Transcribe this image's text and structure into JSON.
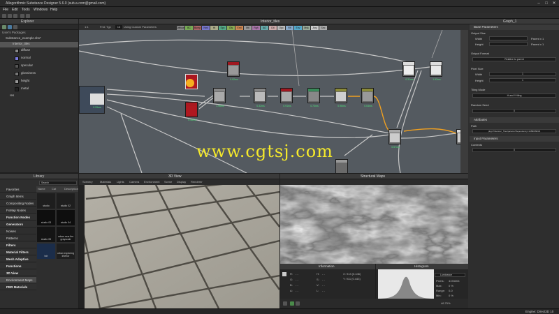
{
  "window": {
    "title": "Allegorithmic Substance Designer 5.6.0 (sub.a.com@gmail.com)",
    "minimize": "–",
    "maximize": "□",
    "close": "✕"
  },
  "menu": [
    "File",
    "Edit",
    "Tools",
    "Windows",
    "Help"
  ],
  "explorer": {
    "title": "Explorer",
    "section": "User's Packages",
    "package": "Substance_example.sbs*",
    "graph": "Interior_tiles",
    "outputs": [
      "diffuse",
      "normal",
      "specular",
      "glossiness",
      "height",
      "metal"
    ],
    "resources": "res"
  },
  "graph": {
    "tab_title": "Interior_tiles",
    "zoom_label": "1:1",
    "format_label": "Fmt: Tgx",
    "format_value": "16",
    "params_label": "Using Custom Parameters",
    "channel_tabs": [
      "Diffuse",
      "BC",
      "Bump",
      "Nml",
      "Ht",
      "Spc",
      "Gls",
      "Emi",
      "Mtl",
      "Rgh",
      "AO",
      "Dtl",
      "Opc",
      "Rfl",
      "Env",
      "Msk",
      "Any",
      "Sec"
    ],
    "nodes": [
      {
        "label": "0.29ms"
      },
      {
        "label": "0.46ms"
      },
      {
        "label": "0.92ms"
      },
      {
        "label": "1.96ms"
      },
      {
        "label": "0.32ms"
      },
      {
        "label": "0.91ms"
      },
      {
        "label": "0.73ms"
      },
      {
        "label": "0.96ms"
      },
      {
        "label": "0.04ms"
      },
      {
        "label": "0.31ms"
      },
      {
        "label": "1.92ms"
      },
      {
        "label": "0.57ms"
      }
    ]
  },
  "watermark": "www.cgtsj.com",
  "properties": {
    "tab": "Graph_1",
    "base_params": "Base Parameters",
    "output_size": "Output Size",
    "width": "Width",
    "height": "Height",
    "width_value": "Parent x 1",
    "height_value": "Parent x 1",
    "output_format": "Output Format",
    "format_value": "Relative to parent",
    "pixel_size": "Pixel Size",
    "px_width": "Width",
    "px_height": "Height",
    "px_width_value": "1",
    "px_height_value": "1",
    "tiling_mode": "Tiling Mode",
    "tiling_value": "H and V tiling",
    "random_seed": "Random Seed",
    "seed_value": "0",
    "attributes": "Attributes",
    "path_label": "Path",
    "path_value": "pkg:///Interiour_Tiles/params?dependency=1489009034",
    "input_params": "Input Parameters",
    "contents": "Contents",
    "contents_value": "0"
  },
  "library": {
    "title": "Library",
    "search_placeholder": "Search",
    "columns": [
      "Name",
      "Cat",
      "Description"
    ],
    "categories": [
      {
        "label": "Favorites",
        "cat": false
      },
      {
        "label": "Graph Items",
        "cat": false
      },
      {
        "label": "Compositing Nodes",
        "cat": false
      },
      {
        "label": "FxMap Nodes",
        "cat": false
      },
      {
        "label": "Function Nodes",
        "cat": true
      },
      {
        "label": "Generators",
        "cat": true
      },
      {
        "label": "Noises",
        "cat": false
      },
      {
        "label": "Patterns",
        "cat": false
      },
      {
        "label": "Filters",
        "cat": true
      },
      {
        "label": "Material Filters",
        "cat": true
      },
      {
        "label": "Mesh Adaptive",
        "cat": true
      },
      {
        "label": "Functions",
        "cat": true
      },
      {
        "label": "3D View",
        "cat": true
      },
      {
        "label": "Environment Maps",
        "cat": false
      },
      {
        "label": "PBR Materials",
        "cat": true
      }
    ],
    "thumbs": [
      "studio",
      "studio 02",
      "studio 03",
      "studio 04",
      "studio 05",
      "urban mus the grayscale",
      "hdr",
      "urban exploring interior"
    ]
  },
  "view3d": {
    "title": "3D View",
    "menu": [
      "Scenery",
      "Materials",
      "Lights",
      "Camera",
      "Environment",
      "Scene",
      "Display",
      "Renderer"
    ]
  },
  "view2d": {
    "title": "Structural Maps",
    "info_tab": "Information",
    "hist_tab": "Histogram",
    "info_rows": [
      {
        "k": "R:",
        "v": "- -",
        "k2": "H:",
        "v2": "- -"
      },
      {
        "k": "G:",
        "v": "- -",
        "k2": "S:",
        "v2": "- -"
      },
      {
        "k": "B:",
        "v": "- -",
        "k2": "V:",
        "v2": "- -"
      },
      {
        "k": "A:",
        "v": "- -",
        "k2": "L:",
        "v2": "- -"
      }
    ],
    "pos_x": "X: 913 (0.446)",
    "pos_y": "Y: 911 (0.443)",
    "channel": "Luminance",
    "stats": [
      {
        "k": "Pixels:",
        "v": "4194304"
      },
      {
        "k": "Max:",
        "v": "0 %"
      },
      {
        "k": "Range:",
        "v": "0-0"
      },
      {
        "k": "Min:",
        "v": "0 %"
      }
    ],
    "zoom": "46.75%"
  },
  "status": {
    "engine": "Engine: Direct3D 10"
  }
}
